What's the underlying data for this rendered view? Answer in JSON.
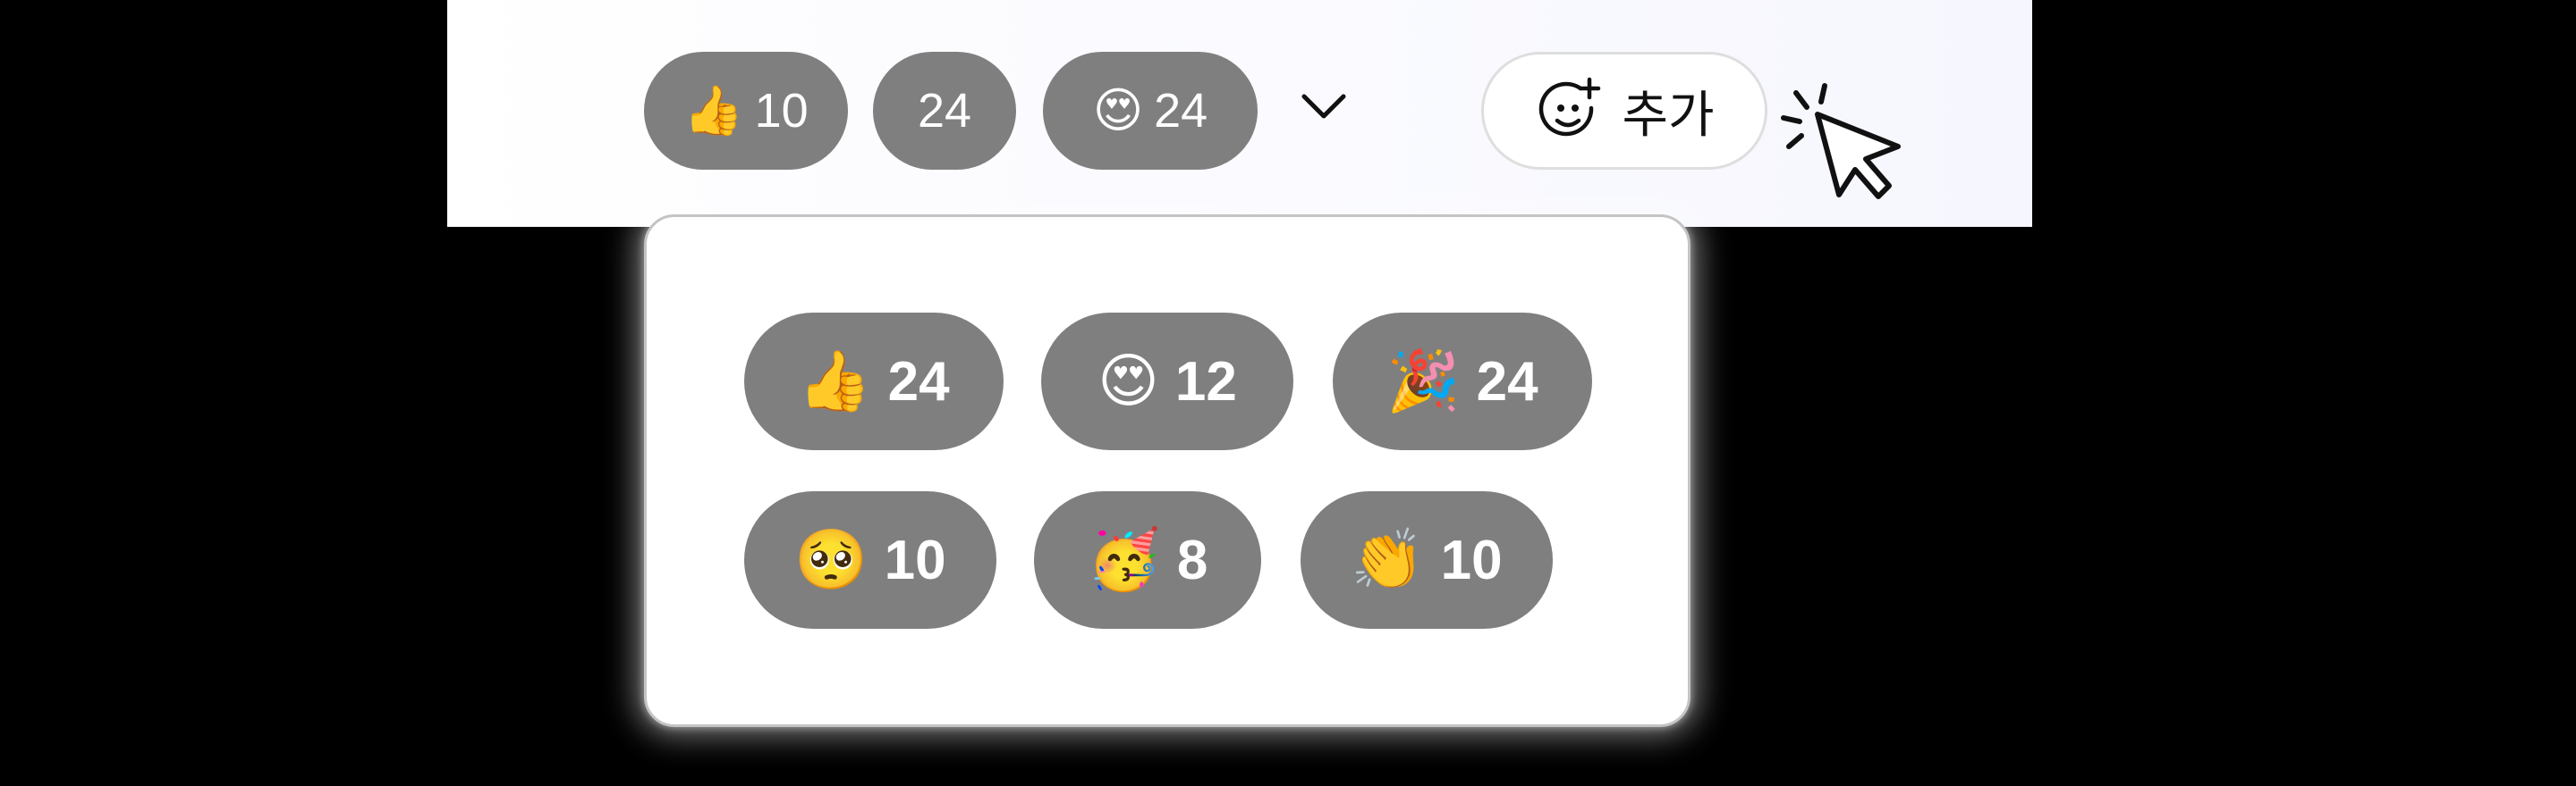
{
  "reaction_bar": {
    "pills": [
      {
        "emoji": "👍",
        "count": "10"
      },
      {
        "emoji": "",
        "count": "24"
      },
      {
        "emoji": "😍",
        "count": "24"
      }
    ],
    "expand_icon": "chevron-down-icon",
    "add_button": {
      "icon": "add-emoji-icon",
      "label": "추가"
    },
    "cursor_icon": "click-cursor-icon"
  },
  "popover": {
    "reactions": [
      {
        "emoji": "👍",
        "count": "24"
      },
      {
        "emoji": "😍",
        "count": "12"
      },
      {
        "emoji": "🎉",
        "count": "24"
      },
      {
        "emoji": "🥺",
        "count": "10"
      },
      {
        "emoji": "🥳",
        "count": "8"
      },
      {
        "emoji": "👏",
        "count": "10"
      }
    ]
  },
  "colors": {
    "pill_bg": "#7f7f7f",
    "pill_text": "#ffffff",
    "bar_bg": "#f6f7fe",
    "add_border": "#dedede",
    "popover_border": "#c4c4c4"
  }
}
